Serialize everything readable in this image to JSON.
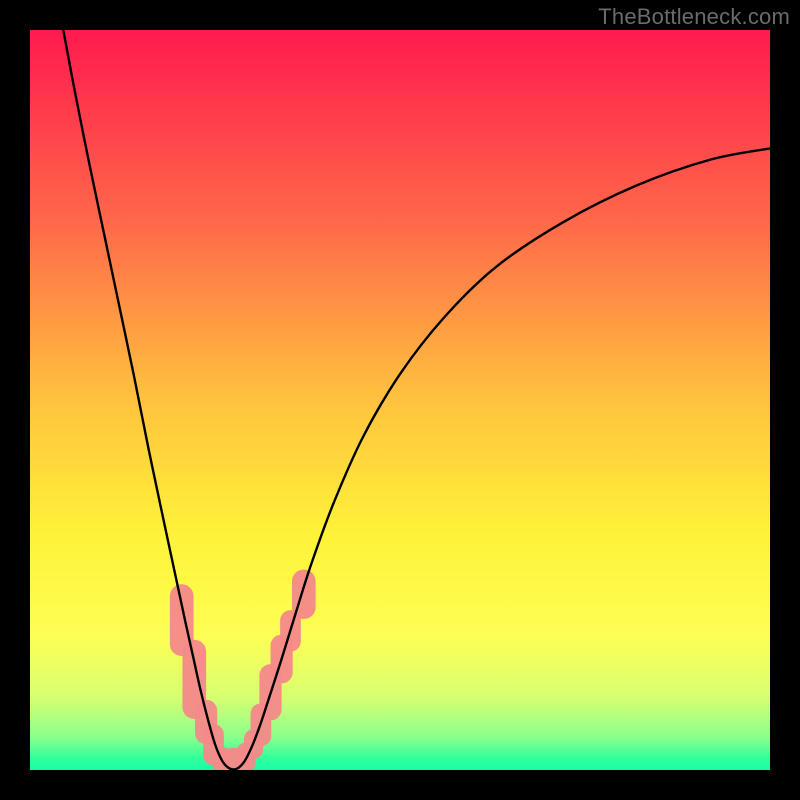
{
  "watermark": {
    "text": "TheBottleneck.com"
  },
  "chart_data": {
    "type": "line",
    "title": "",
    "xlabel": "",
    "ylabel": "",
    "xlim": [
      0,
      100
    ],
    "ylim": [
      0,
      100
    ],
    "legendVisible": false,
    "gradient": {
      "stops": [
        {
          "offset": 0.0,
          "color": "#ff1a4e"
        },
        {
          "offset": 0.25,
          "color": "#ff654a"
        },
        {
          "offset": 0.5,
          "color": "#ffc23e"
        },
        {
          "offset": 0.68,
          "color": "#fff238"
        },
        {
          "offset": 0.82,
          "color": "#fdff55"
        },
        {
          "offset": 0.9,
          "color": "#d8ff70"
        },
        {
          "offset": 0.955,
          "color": "#8cff8c"
        },
        {
          "offset": 0.985,
          "color": "#2fff9c"
        },
        {
          "offset": 1.0,
          "color": "#18ffa5"
        }
      ]
    },
    "series": [
      {
        "name": "curve",
        "color": "#000000",
        "width": 2.4,
        "points": [
          {
            "x": 4.5,
            "y": 100.0
          },
          {
            "x": 6.0,
            "y": 92.0
          },
          {
            "x": 8.0,
            "y": 82.0
          },
          {
            "x": 10.0,
            "y": 72.5
          },
          {
            "x": 12.0,
            "y": 63.0
          },
          {
            "x": 14.0,
            "y": 53.5
          },
          {
            "x": 16.0,
            "y": 43.5
          },
          {
            "x": 18.0,
            "y": 34.0
          },
          {
            "x": 19.5,
            "y": 27.0
          },
          {
            "x": 21.0,
            "y": 20.0
          },
          {
            "x": 22.0,
            "y": 15.5
          },
          {
            "x": 23.0,
            "y": 11.0
          },
          {
            "x": 24.0,
            "y": 7.0
          },
          {
            "x": 25.0,
            "y": 3.5
          },
          {
            "x": 26.0,
            "y": 1.2
          },
          {
            "x": 27.0,
            "y": 0.2
          },
          {
            "x": 28.0,
            "y": 0.2
          },
          {
            "x": 29.0,
            "y": 1.2
          },
          {
            "x": 30.0,
            "y": 3.2
          },
          {
            "x": 31.0,
            "y": 5.8
          },
          {
            "x": 32.0,
            "y": 8.8
          },
          {
            "x": 34.0,
            "y": 15.0
          },
          {
            "x": 36.0,
            "y": 21.5
          },
          {
            "x": 38.0,
            "y": 27.8
          },
          {
            "x": 41.0,
            "y": 36.0
          },
          {
            "x": 45.0,
            "y": 45.0
          },
          {
            "x": 50.0,
            "y": 53.5
          },
          {
            "x": 56.0,
            "y": 61.2
          },
          {
            "x": 63.0,
            "y": 68.0
          },
          {
            "x": 72.0,
            "y": 74.0
          },
          {
            "x": 82.0,
            "y": 79.0
          },
          {
            "x": 92.0,
            "y": 82.5
          },
          {
            "x": 100.0,
            "y": 84.0
          }
        ]
      }
    ],
    "markers": {
      "color": "#f58a8a",
      "entries": [
        {
          "x": 20.5,
          "y1": 17.0,
          "y2": 23.5,
          "w": 3.2
        },
        {
          "x": 22.2,
          "y1": 8.5,
          "y2": 16.0,
          "w": 3.2
        },
        {
          "x": 23.8,
          "y1": 5.0,
          "y2": 8.0,
          "w": 3.0
        },
        {
          "x": 24.8,
          "y1": 2.0,
          "y2": 4.8,
          "w": 2.8
        },
        {
          "x": 26.0,
          "y1": 0.6,
          "y2": 1.8,
          "w": 2.6
        },
        {
          "x": 27.5,
          "y1": 0.0,
          "y2": 0.9,
          "w": 4.2
        },
        {
          "x": 29.2,
          "y1": 1.0,
          "y2": 2.4,
          "w": 2.6
        },
        {
          "x": 30.2,
          "y1": 2.8,
          "y2": 4.2,
          "w": 2.6
        },
        {
          "x": 31.2,
          "y1": 4.6,
          "y2": 7.6,
          "w": 2.8
        },
        {
          "x": 32.5,
          "y1": 8.2,
          "y2": 12.8,
          "w": 3.0
        },
        {
          "x": 34.0,
          "y1": 13.2,
          "y2": 16.8,
          "w": 3.0
        },
        {
          "x": 35.2,
          "y1": 17.4,
          "y2": 20.2,
          "w": 2.8
        },
        {
          "x": 37.0,
          "y1": 22.0,
          "y2": 25.5,
          "w": 3.2
        }
      ]
    }
  }
}
